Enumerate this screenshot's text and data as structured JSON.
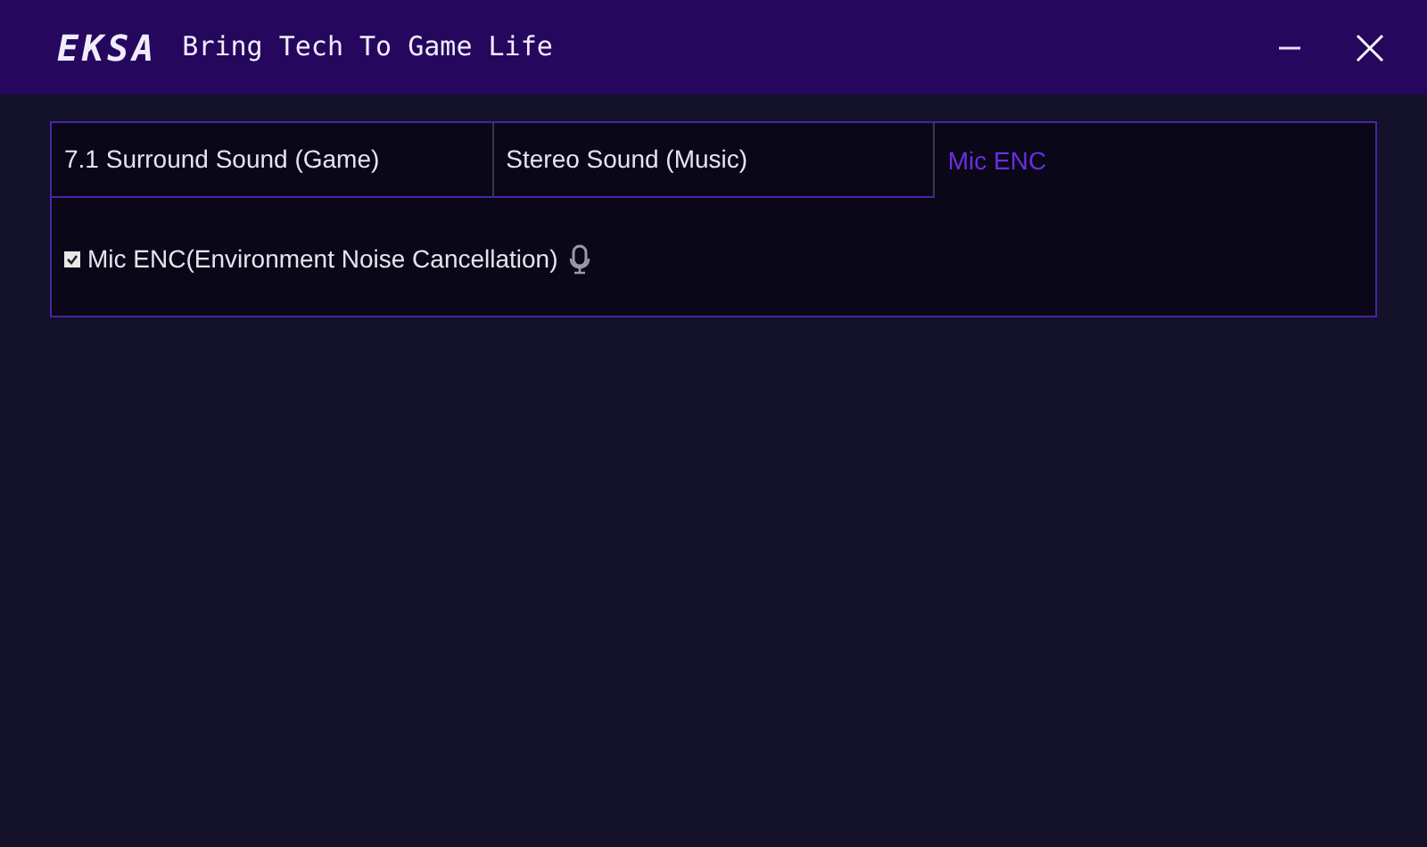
{
  "window": {
    "logo": "EKSA",
    "tagline": "Bring Tech To Game Life"
  },
  "tabs": [
    {
      "label": "7.1 Surround Sound (Game)",
      "selected": false
    },
    {
      "label": "Stereo Sound (Music)",
      "selected": false
    },
    {
      "label": "Mic ENC",
      "selected": true
    }
  ],
  "options": [
    {
      "label": "Mic ENC(Environment Noise Cancellation)",
      "checked": true
    }
  ]
}
